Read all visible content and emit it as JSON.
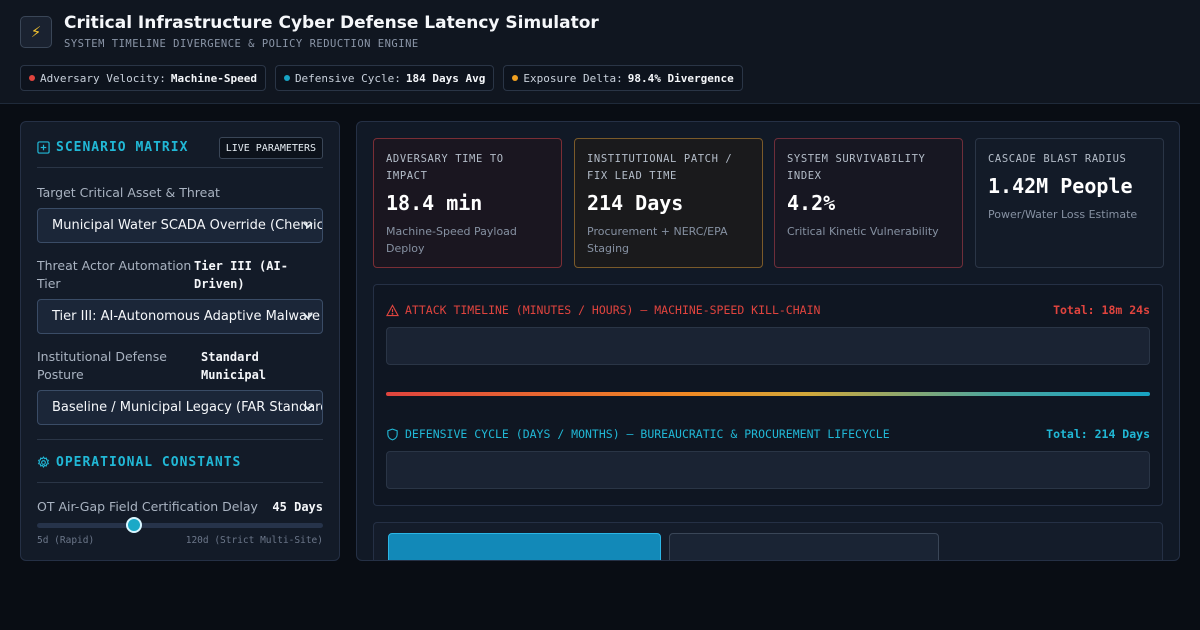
{
  "header": {
    "logo_icon": "lightning-bolt-icon",
    "title": "Critical Infrastructure Cyber Defense Latency Simulator",
    "subtitle": "SYSTEM TIMELINE DIVERGENCE & POLICY REDUCTION ENGINE",
    "pills": [
      {
        "label": "Adversary Velocity:",
        "value": "Machine-Speed",
        "color": "#e0443e"
      },
      {
        "label": "Defensive Cycle:",
        "value": "184 Days Avg",
        "color": "#17a3c4"
      },
      {
        "label": "Exposure Delta:",
        "value": "98.4% Divergence",
        "color": "#f0a020"
      }
    ]
  },
  "scenario": {
    "title": "SCENARIO MATRIX",
    "live_label": "LIVE PARAMETERS",
    "asset_label": "Target Critical Asset & Threat",
    "asset_selected": "Municipal Water SCADA Override (Chemical Dosing)",
    "actor_label": "Threat Actor Automation Tier",
    "actor_value": "Tier III (AI-Driven)",
    "actor_selected": "Tier III: AI-Autonomous Adaptive Malware",
    "posture_label": "Institutional Defense Posture",
    "posture_value": "Standard Municipal",
    "posture_selected": "Baseline / Municipal Legacy (FAR Standard)"
  },
  "constants": {
    "title": "OPERATIONAL CONSTANTS",
    "airgap_label": "OT Air-Gap Field Certification Delay",
    "airgap_value": "45 Days",
    "airgap_fraction": 0.34,
    "airgap_min": "5d (Rapid)",
    "airgap_max": "120d (Strict Multi-Site)"
  },
  "cards": [
    {
      "label": "ADVERSARY TIME TO IMPACT",
      "value": "18.4 min",
      "note": "Machine-Speed Payload Deploy",
      "border": "#7a2e35",
      "bg": "#1a1620"
    },
    {
      "label": "INSTITUTIONAL PATCH / FIX LEAD TIME",
      "value": "214 Days",
      "note": "Procurement + NERC/EPA Staging",
      "border": "#7a5a2a",
      "bg": "#1a1a1c"
    },
    {
      "label": "SYSTEM SURVIVABILITY INDEX",
      "value": "4.2%",
      "note": "Critical Kinetic Vulnerability",
      "border": "#6e2e3a",
      "bg": "#171722"
    },
    {
      "label": "CASCADE BLAST RADIUS",
      "value": "1.42M People",
      "note": "Power/Water Loss Estimate",
      "border": "#2a3546",
      "bg": "#131b28"
    }
  ],
  "attack_timeline": {
    "title": "ATTACK TIMELINE (MINUTES / HOURS) — MACHINE-SPEED KILL-CHAIN",
    "total": "Total: 18m 24s",
    "color": "#e0443e"
  },
  "defense_timeline": {
    "title": "DEFENSIVE CYCLE (DAYS / MONTHS) — BUREAUCRATIC & PROCUREMENT LIFECYCLE",
    "total": "Total: 214 Days",
    "color": "#21b8d6"
  }
}
